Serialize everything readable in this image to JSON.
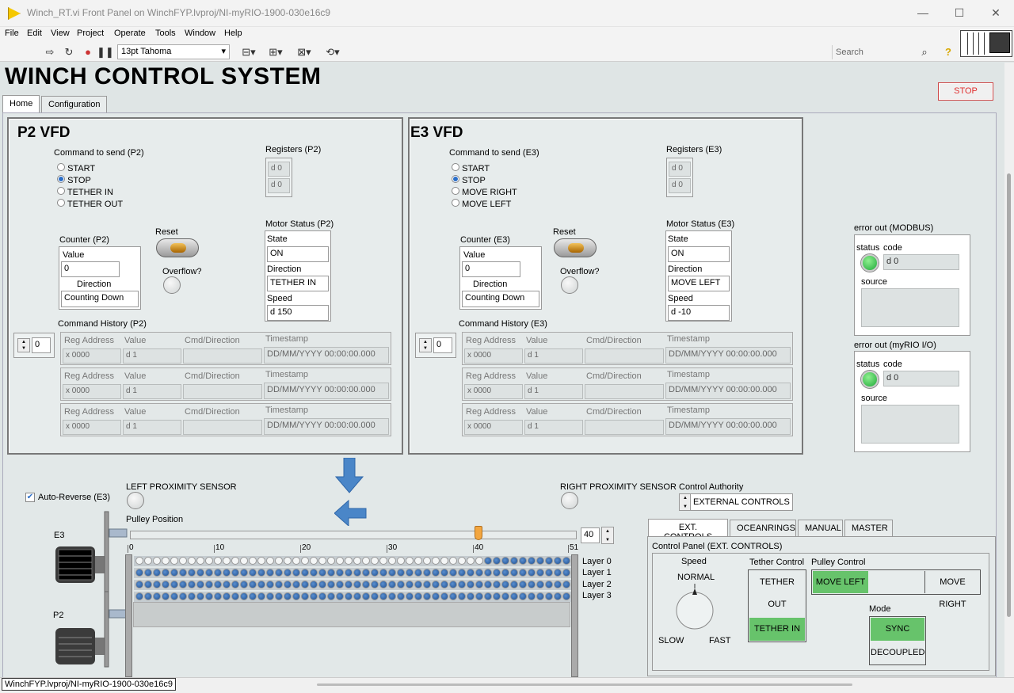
{
  "window": {
    "title": "Winch_RT.vi Front Panel on WinchFYP.lvproj/NI-myRIO-1900-030e16c9"
  },
  "menu": [
    "File",
    "Edit",
    "View",
    "Project",
    "Operate",
    "Tools",
    "Window",
    "Help"
  ],
  "toolbar": {
    "font": "13pt Tahoma",
    "search_placeholder": "Search"
  },
  "main_title": "WINCH CONTROL SYSTEM",
  "stop_label": "STOP",
  "tabs": [
    "Home",
    "Configuration"
  ],
  "p2": {
    "title": "P2 VFD",
    "command_label": "Command to send (P2)",
    "commands": [
      "START",
      "STOP",
      "TETHER IN",
      "TETHER OUT"
    ],
    "selected_command": 1,
    "registers_label": "Registers (P2)",
    "registers": [
      "d 0",
      "d 0"
    ],
    "counter_label": "Counter (P2)",
    "value_label": "Value",
    "value": "0",
    "direction_label": "Direction",
    "direction": "Counting Down",
    "reset_label": "Reset",
    "overflow_label": "Overflow?",
    "motor_label": "Motor Status (P2)",
    "state_label": "State",
    "state": "ON",
    "dir_label": "Direction",
    "dir": "TETHER IN",
    "speed_label": "Speed",
    "speed": "d 150",
    "history_label": "Command History (P2)",
    "history_index": "0"
  },
  "e3": {
    "title": "E3 VFD",
    "command_label": "Command to send (E3)",
    "commands": [
      "START",
      "STOP",
      "MOVE RIGHT",
      "MOVE LEFT"
    ],
    "selected_command": 1,
    "registers_label": "Registers (E3)",
    "registers": [
      "d 0",
      "d 0"
    ],
    "counter_label": "Counter (E3)",
    "value_label": "Value",
    "value": "0",
    "direction_label": "Direction",
    "direction": "Counting Down",
    "reset_label": "Reset",
    "overflow_label": "Overflow?",
    "motor_label": "Motor Status (E3)",
    "state_label": "State",
    "state": "ON",
    "dir_label": "Direction",
    "dir": "MOVE LEFT",
    "speed_label": "Speed",
    "speed": "d -10",
    "history_label": "Command History (E3)",
    "history_index": "0"
  },
  "history_headers": {
    "reg": "Reg Address",
    "value": "Value",
    "cmd": "Cmd/Direction",
    "ts": "Timestamp"
  },
  "history_row": {
    "reg": "x 0000",
    "value": "d 1",
    "cmd": "",
    "ts": "DD/MM/YYYY 00:00:00.000"
  },
  "errors": [
    {
      "title": "error out (MODBUS)",
      "status": "status",
      "code_label": "code",
      "code": "d 0",
      "source": "source"
    },
    {
      "title": "error out (myRIO I/O)",
      "status": "status",
      "code_label": "code",
      "code": "d 0",
      "source": "source"
    }
  ],
  "auto_reverse": {
    "label": "Auto-Reverse (E3)",
    "checked": true
  },
  "left_sensor": "LEFT PROXIMITY SENSOR",
  "right_sensor": "RIGHT PROXIMITY SENSOR",
  "pulley": {
    "label": "Pulley Position",
    "value": "40",
    "max": 51,
    "ticks": [
      "0",
      "10",
      "20",
      "30",
      "40",
      "51"
    ]
  },
  "motor_labels": {
    "top": "E3",
    "bottom": "P2"
  },
  "layers": [
    "Layer 0",
    "Layer 1",
    "Layer 2",
    "Layer 3"
  ],
  "layer_fill": {
    "layer0_filled_from": 40,
    "layers_filled": [
      false,
      true,
      true,
      true
    ]
  },
  "control_authority": {
    "label": "Control Authority",
    "value": "EXTERNAL CONTROLS"
  },
  "ctrl_tabs": [
    "EXT. CONTROLS",
    "OCEANRINGS",
    "MANUAL",
    "MASTER"
  ],
  "control_panel": {
    "title": "Control Panel (EXT. CONTROLS)",
    "speed_label": "Speed",
    "speed_value": "NORMAL",
    "slow": "SLOW",
    "fast": "FAST",
    "tether_label": "Tether Control",
    "tether_out": "TETHER OUT",
    "tether_in": "TETHER IN",
    "pulley_label": "Pulley Control",
    "move_left": "MOVE LEFT",
    "move_right": "MOVE RIGHT",
    "mode_label": "Mode",
    "sync": "SYNC",
    "decoupled": "DECOUPLED"
  },
  "status_bar": "WinchFYP.lvproj/NI-myRIO-1900-030e16c9"
}
